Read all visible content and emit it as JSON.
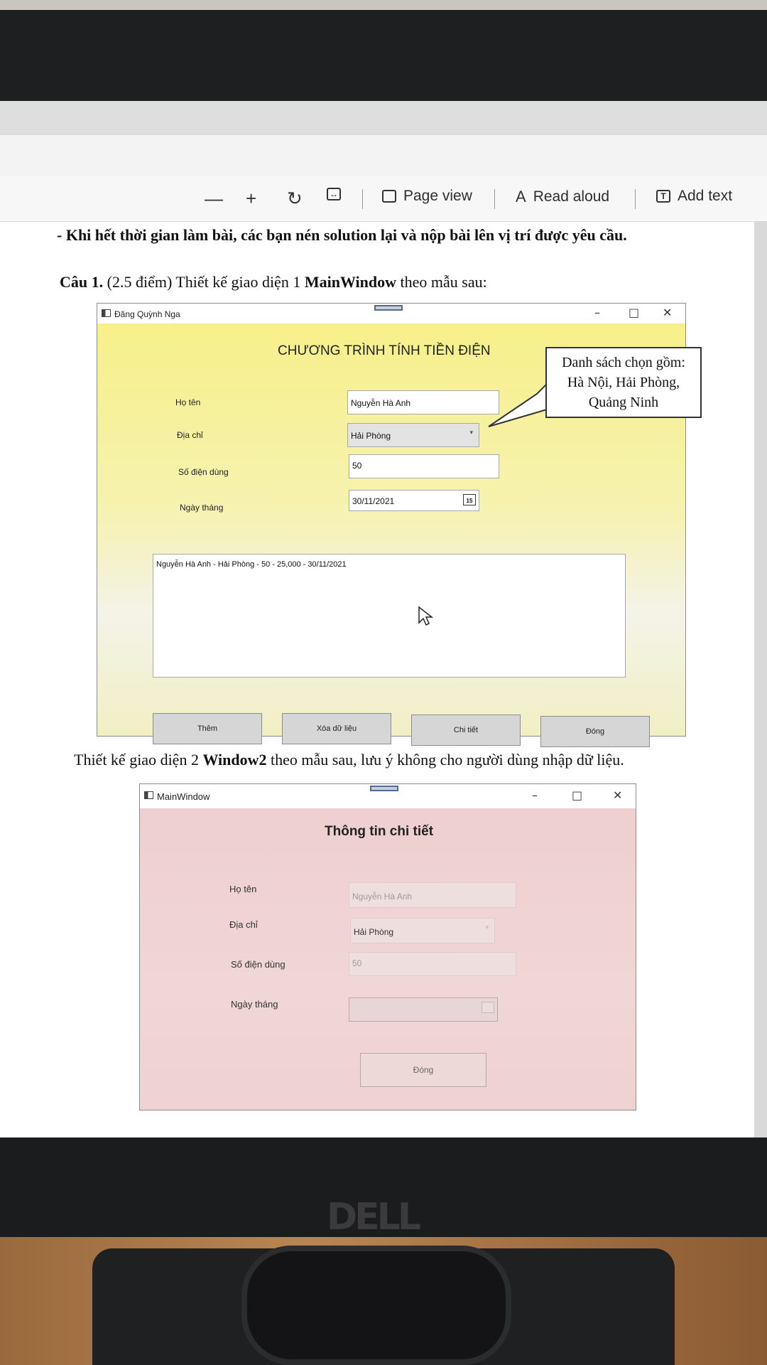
{
  "toolbar": {
    "zoom_out": "—",
    "zoom_in": "+",
    "page_view_label": "Page view",
    "read_aloud_label": "Read aloud",
    "add_text_label": "Add text"
  },
  "document": {
    "line1": "- Khi hết thời gian làm bài, các bạn nén solution lại và nộp bài lên vị trí được yêu cầu.",
    "cau1_prefix": "Câu 1.",
    "cau1_mid": " (2.5 điểm) Thiết kế giao diện 1 ",
    "cau1_bold": "MainWindow",
    "cau1_suffix": " theo mẫu sau:",
    "window2_prefix": "Thiết kế giao diện 2 ",
    "window2_bold": "Window2",
    "window2_suffix": " theo mẫu sau, lưu ý không cho người dùng nhập dữ liệu."
  },
  "window1": {
    "title": "Đăng Quỳnh Nga",
    "heading": "CHƯƠNG TRÌNH TÍNH TIỀN ĐIỆN",
    "labels": {
      "ho_ten": "Họ tên",
      "dia_chi": "Địa chỉ",
      "so_dien": "Số điện dùng",
      "ngay": "Ngày tháng"
    },
    "values": {
      "ho_ten": "Nguyễn Hà Anh",
      "dia_chi": "Hải Phòng",
      "so_dien": "50",
      "ngay": "30/11/2021",
      "calendar_day": "15"
    },
    "list_item": "Nguyễn Hà Anh - Hải Phòng - 50 - 25,000 - 30/11/2021",
    "buttons": {
      "them": "Thêm",
      "xoa": "Xóa dữ liệu",
      "chi_tiet": "Chi tiết",
      "dong": "Đóng"
    },
    "colors": {
      "background": "#f7f08a"
    }
  },
  "callout": {
    "line1": "Danh sách chọn gồm:",
    "line2": "Hà Nội, Hải Phòng,",
    "line3": "Quảng Ninh"
  },
  "window2": {
    "title": "MainWindow",
    "heading": "Thông tin chi tiết",
    "labels": {
      "ho_ten": "Họ tên",
      "dia_chi": "Địa chỉ",
      "so_dien": "Số điện dùng",
      "ngay": "Ngày tháng"
    },
    "values": {
      "ho_ten": "Nguyễn Hà Anh",
      "dia_chi": "Hải Phòng",
      "so_dien": "50"
    },
    "button_dong": "Đóng",
    "colors": {
      "background": "#f0d2d2"
    }
  },
  "monitor": {
    "brand": "DELL"
  }
}
